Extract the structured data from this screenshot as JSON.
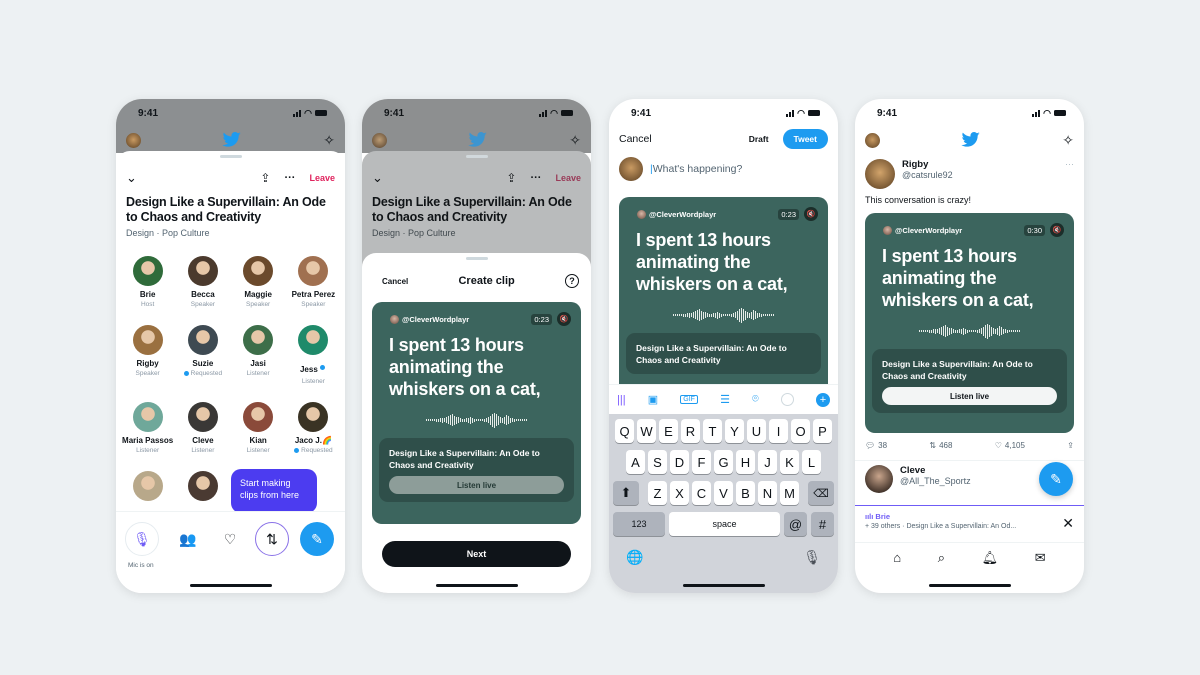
{
  "status_time": "9:41",
  "colors": {
    "background": "#edf1f3",
    "twitter_blue": "#1d9bf0",
    "leave_red": "#e0245e",
    "clip_card": "#3c655e",
    "tooltip_purple": "#4c3cf0",
    "spaces_purple": "#6f5cf6"
  },
  "space": {
    "title": "Design Like a Supervillain: An Ode to Chaos and Creativity",
    "topics": "Design · Pop Culture",
    "leave_label": "Leave"
  },
  "participants": [
    {
      "name": "Brie",
      "role": "Host",
      "color": "#2f6b3a"
    },
    {
      "name": "Becca",
      "role": "Speaker",
      "color": "#4b3a2d"
    },
    {
      "name": "Maggie",
      "role": "Speaker",
      "color": "#6b4a2c"
    },
    {
      "name": "Petra Perez",
      "role": "Speaker",
      "color": "#a07050"
    },
    {
      "name": "Rigby",
      "role": "Speaker",
      "color": "#9a7040"
    },
    {
      "name": "Suzie",
      "role": "Requested",
      "color": "#3e4a52"
    },
    {
      "name": "Jasi",
      "role": "Listener",
      "color": "#3d6e49"
    },
    {
      "name": "Jess",
      "role": "Listener",
      "color": "#1f8a6a",
      "verified": true
    },
    {
      "name": "Maria Passos",
      "role": "Listener",
      "color": "#6fa89a"
    },
    {
      "name": "Cleve",
      "role": "Listener",
      "color": "#3a3836"
    },
    {
      "name": "Kian",
      "role": "Listener",
      "color": "#8a4a3a"
    },
    {
      "name": "Jaco J.🌈",
      "role": "Requested",
      "color": "#3a3324"
    },
    {
      "name": "",
      "role": "",
      "color": "#b8a88a"
    },
    {
      "name": "",
      "role": "",
      "color": "#4a3a32"
    }
  ],
  "tooltip": "Start making clips from here",
  "bottom_bar": {
    "mic_label": "Mic is on"
  },
  "clip_sheet": {
    "cancel": "Cancel",
    "title": "Create clip",
    "help": "?",
    "next": "Next"
  },
  "clip_card": {
    "handle": "@CleverWordplayr",
    "duration": "0:23",
    "quote": "I spent 13 hours animating the whiskers on a cat,",
    "space_title": "Design Like a Supervillain: An Ode to Chaos and Creativity",
    "listen_live": "Listen live"
  },
  "composer": {
    "cancel": "Cancel",
    "draft": "Draft",
    "tweet": "Tweet",
    "placeholder": "What's happening?"
  },
  "keyboard": {
    "row1": [
      "Q",
      "W",
      "E",
      "R",
      "T",
      "Y",
      "U",
      "I",
      "O",
      "P"
    ],
    "row2": [
      "A",
      "S",
      "D",
      "F",
      "G",
      "H",
      "J",
      "K",
      "L"
    ],
    "row3": [
      "Z",
      "X",
      "C",
      "V",
      "B",
      "N",
      "M"
    ],
    "num": "123",
    "space": "space",
    "at": "@",
    "hash": "#"
  },
  "timeline": {
    "tweet": {
      "name": "Rigby",
      "handle": "@catsrule92",
      "text": "This conversation is crazy!",
      "duration": "0:30",
      "replies": "38",
      "retweets": "468",
      "likes": "4,105"
    },
    "tweet2": {
      "name": "Cleve",
      "handle": "@All_The_Sportz"
    },
    "space_bar": {
      "host": "Brie",
      "subtitle": "+ 39 others · Design Like a Supervillain: An Od..."
    }
  }
}
